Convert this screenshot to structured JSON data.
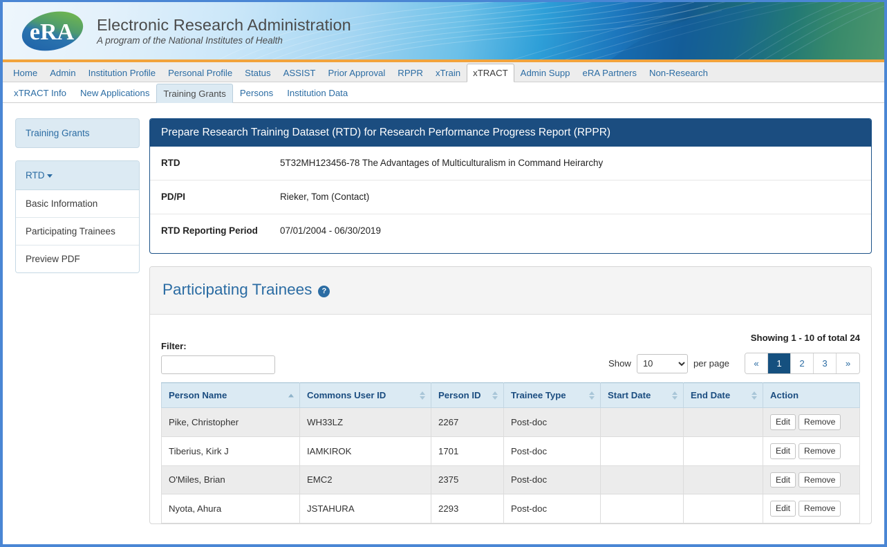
{
  "brand": {
    "logo_text": "eRA",
    "title": "Electronic Research Administration",
    "subtitle": "A program of the National Institutes of Health"
  },
  "nav_primary": [
    {
      "label": "Home",
      "active": false
    },
    {
      "label": "Admin",
      "active": false
    },
    {
      "label": "Institution Profile",
      "active": false
    },
    {
      "label": "Personal Profile",
      "active": false
    },
    {
      "label": "Status",
      "active": false
    },
    {
      "label": "ASSIST",
      "active": false
    },
    {
      "label": "Prior Approval",
      "active": false
    },
    {
      "label": "RPPR",
      "active": false
    },
    {
      "label": "xTrain",
      "active": false
    },
    {
      "label": "xTRACT",
      "active": true
    },
    {
      "label": "Admin Supp",
      "active": false
    },
    {
      "label": "eRA Partners",
      "active": false
    },
    {
      "label": "Non-Research",
      "active": false
    }
  ],
  "nav_secondary": [
    {
      "label": "xTRACT Info",
      "active": false
    },
    {
      "label": "New Applications",
      "active": false
    },
    {
      "label": "Training Grants",
      "active": true
    },
    {
      "label": "Persons",
      "active": false
    },
    {
      "label": "Institution Data",
      "active": false
    }
  ],
  "sidebar": {
    "section_label": "Training Grants",
    "menu_header": "RTD",
    "items": [
      {
        "label": "Basic Information"
      },
      {
        "label": "Participating Trainees"
      },
      {
        "label": "Preview PDF"
      }
    ]
  },
  "rtd_panel": {
    "header": "Prepare Research Training Dataset (RTD) for Research Performance Progress Report (RPPR)",
    "rows": [
      {
        "label": "RTD",
        "value": "5T32MH123456-78 The Advantages of Multiculturalism in Command Heirarchy"
      },
      {
        "label": "PD/PI",
        "value": "Rieker, Tom (Contact)"
      },
      {
        "label": "RTD Reporting Period",
        "value": "07/01/2004 - 06/30/2019"
      }
    ]
  },
  "trainees": {
    "title": "Participating Trainees",
    "help_icon_glyph": "?",
    "filter_label": "Filter:",
    "filter_value": "",
    "filter_placeholder": "",
    "showing_text": "Showing 1 - 10 of total 24",
    "show_label": "Show",
    "per_page_label": "per page",
    "per_page_value": "10",
    "per_page_options": [
      "10",
      "25",
      "50",
      "100"
    ],
    "pagination": [
      {
        "label": "«",
        "active": false
      },
      {
        "label": "1",
        "active": true
      },
      {
        "label": "2",
        "active": false
      },
      {
        "label": "3",
        "active": false
      },
      {
        "label": "»",
        "active": false
      }
    ],
    "columns": [
      {
        "label": "Person Name",
        "sort": "asc"
      },
      {
        "label": "Commons User ID",
        "sort": "none"
      },
      {
        "label": "Person ID",
        "sort": "none"
      },
      {
        "label": "Trainee Type",
        "sort": "none"
      },
      {
        "label": "Start Date",
        "sort": "none"
      },
      {
        "label": "End Date",
        "sort": "none"
      },
      {
        "label": "Action",
        "sort": null
      }
    ],
    "rows": [
      {
        "person_name": "Pike, Christopher",
        "commons_user_id": "WH33LZ",
        "person_id": "2267",
        "trainee_type": "Post-doc",
        "start_date": "",
        "end_date": "",
        "edit": "Edit",
        "remove": "Remove"
      },
      {
        "person_name": "Tiberius, Kirk J",
        "commons_user_id": "IAMKIROK",
        "person_id": "1701",
        "trainee_type": "Post-doc",
        "start_date": "",
        "end_date": "",
        "edit": "Edit",
        "remove": "Remove"
      },
      {
        "person_name": "O'Miles, Brian",
        "commons_user_id": "EMC2",
        "person_id": "2375",
        "trainee_type": "Post-doc",
        "start_date": "",
        "end_date": "",
        "edit": "Edit",
        "remove": "Remove"
      },
      {
        "person_name": "Nyota, Ahura",
        "commons_user_id": "JSTAHURA",
        "person_id": "2293",
        "trainee_type": "Post-doc",
        "start_date": "",
        "end_date": "",
        "edit": "Edit",
        "remove": "Remove"
      }
    ]
  },
  "colors": {
    "accent_blue": "#1b4d80",
    "link_blue": "#2b6ca3",
    "orange_rule": "#f2a33c",
    "page_border": "#4a86d4",
    "table_header": "#dbeaf3"
  }
}
